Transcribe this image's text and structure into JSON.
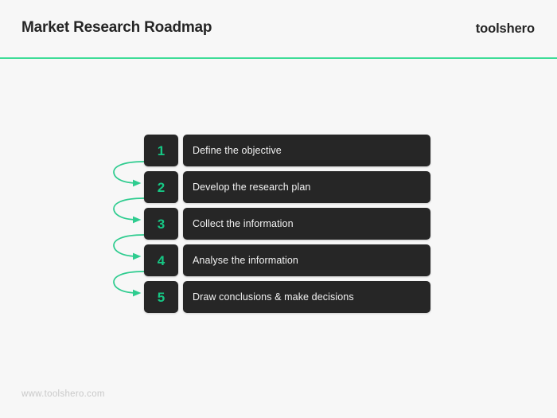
{
  "header": {
    "title": "Market Research Roadmap",
    "brand": "toolshero",
    "divider_color": "#3ddc97"
  },
  "roadmap": {
    "accent_color": "#16c784",
    "box_color": "#262626",
    "steps": [
      {
        "number": "1",
        "label": "Define the objective"
      },
      {
        "number": "2",
        "label": "Develop the research plan"
      },
      {
        "number": "3",
        "label": "Collect the information"
      },
      {
        "number": "4",
        "label": "Analyse the information"
      },
      {
        "number": "5",
        "label": "Draw conclusions & make decisions"
      }
    ]
  },
  "footer": {
    "url": "www.toolshero.com"
  }
}
